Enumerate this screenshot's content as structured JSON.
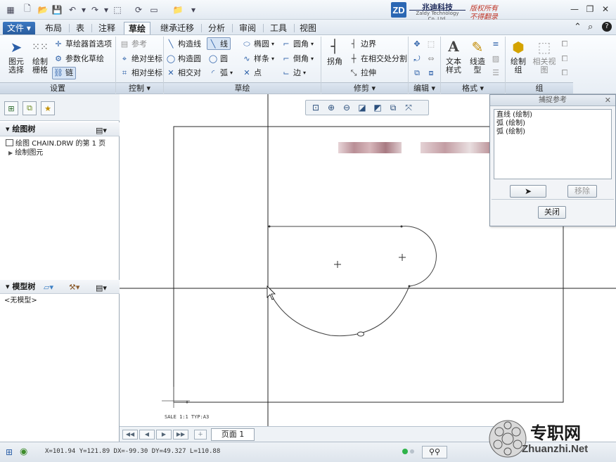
{
  "brand": {
    "logo_letters": "ZD",
    "name": "兆迪科技",
    "name_en": "Zaldy Technology Co.,Ltd.",
    "copyright_1": "版权所有",
    "copyright_2": "不得翻录"
  },
  "tabs": [
    "文件",
    "布局",
    "表",
    "注释",
    "草绘",
    "继承迁移",
    "分析",
    "审阅",
    "工具",
    "视图"
  ],
  "active_tab": "草绘",
  "ribbon": {
    "settings": {
      "select_label": "图元\n选择",
      "grid_label": "绘制\n栅格",
      "sketcher_prefs": "草绘器首选项",
      "param_sketch": "参数化草绘",
      "chain": "链",
      "group": "设置"
    },
    "control": {
      "reference": "参考",
      "absolute_coord": "绝对坐标",
      "relative_coord": "相对坐标",
      "group": "控制"
    },
    "sketch": {
      "construction_line": "构造线",
      "construction_circle": "构造圆",
      "intersect": "相交对",
      "line": "线",
      "circle": "圆",
      "arc": "弧",
      "ellipse": "椭圆",
      "spline": "样条",
      "point": "点",
      "fillet": "圆角",
      "chamfer": "倒角",
      "edge": "边",
      "group": "草绘"
    },
    "trim": {
      "corner": "拐角",
      "boundary": "边界",
      "divide_at_intersect": "在相交处分割",
      "stretch": "拉伸",
      "group": "修剪"
    },
    "edit": {
      "group": "编辑"
    },
    "format": {
      "text_style": "文本\n样式",
      "line_style": "线造\n型",
      "group": "格式"
    },
    "group_grp": {
      "draw_group": "绘制\n组",
      "related_view": "相关视\n图",
      "group": "组"
    }
  },
  "left_pane": {
    "drawing_tree_title": "绘图树",
    "drawing_tree_items": [
      "绘图 CHAIN.DRW 的第 1 页",
      "绘制图元"
    ],
    "model_tree_title": "模型树",
    "model_tree_empty": "<无模型>"
  },
  "dialog": {
    "title": "捕捉参考",
    "items": [
      "直线 (绘制)",
      "弧 (绘制)",
      "弧 (绘制)"
    ],
    "remove": "移除",
    "close": "关闭"
  },
  "sheet": {
    "page_label": "页面 1",
    "scale_note": "SALE 1:1  TYP:A3"
  },
  "status": {
    "coords": "X=101.94 Y=121.89 DX=-99.30 DY=49.327 L=110.88"
  },
  "watermark": {
    "text": "专职网",
    "url": "Zhuanzhi.Net"
  }
}
